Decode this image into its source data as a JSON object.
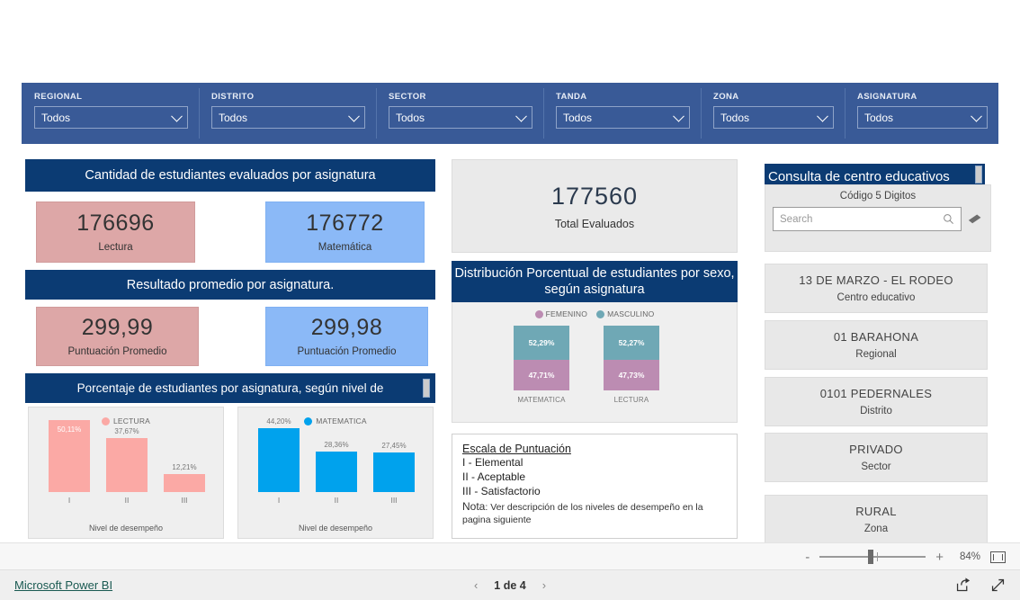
{
  "filters": {
    "slicers": [
      {
        "label": "REGIONAL",
        "value": "Todos"
      },
      {
        "label": "DISTRITO",
        "value": "Todos"
      },
      {
        "label": "SECTOR",
        "value": "Todos"
      },
      {
        "label": "TANDA",
        "value": "Todos"
      },
      {
        "label": "ZONA",
        "value": "Todos"
      },
      {
        "label": "ASIGNATURA",
        "value": "Todos"
      }
    ]
  },
  "left": {
    "title_cantidad": "Cantidad de estudiantes evaluados por asignatura",
    "title_resultado": "Resultado promedio por asignatura.",
    "title_porcentaje": "Porcentaje de estudiantes por asignatura, según nivel de",
    "kpis": [
      {
        "value": "176696",
        "label": "Lectura"
      },
      {
        "value": "176772",
        "label": "Matemática"
      },
      {
        "value": "299,99",
        "label": "Puntuación Promedio"
      },
      {
        "value": "299,98",
        "label": "Puntuación Promedio"
      }
    ]
  },
  "center": {
    "total_value": "177560",
    "total_label": "Total Evaluados",
    "title_distribucion": "Distribución Porcentual de estudiantes por sexo, según asignatura",
    "escala": {
      "heading": "Escala de Puntuación",
      "line1": "I - Elemental",
      "line2": "II - Aceptable",
      "line3": "III - Satisfactorio",
      "nota_label": "Nota",
      "nota_text": ": Ver descripción de los niveles de desempeño en la pagina siguiente"
    }
  },
  "right": {
    "title": "Consulta de centro educativos",
    "search_caption": "Código 5 Digitos",
    "search_placeholder": "Search",
    "cards": [
      {
        "value": "13 DE MARZO - EL RODEO",
        "label": "Centro educativo"
      },
      {
        "value": "01 BARAHONA",
        "label": "Regional"
      },
      {
        "value": "0101  PEDERNALES",
        "label": "Distrito"
      },
      {
        "value": "PRIVADO",
        "label": "Sector"
      },
      {
        "value": "RURAL",
        "label": "Zona"
      }
    ]
  },
  "statusbar": {
    "zoom_minus": "-",
    "zoom_plus": "+",
    "zoom_percent": "84%"
  },
  "footer": {
    "brand": "Microsoft Power BI",
    "prev": "‹",
    "page": "1 de 4",
    "next": "›"
  },
  "chart_data": [
    {
      "type": "bar",
      "title": "",
      "legend": [
        "LECTURA"
      ],
      "legend_position": "top",
      "categories": [
        "I",
        "II",
        "III"
      ],
      "values": [
        50.11,
        37.67,
        12.21
      ],
      "value_labels": [
        "50,11%",
        "37,67%",
        "12,21%"
      ],
      "xlabel": "Nivel de desempeño",
      "ylabel": "",
      "ylim": [
        0,
        55
      ],
      "color": "#fba9a5",
      "grid": false
    },
    {
      "type": "bar",
      "title": "",
      "legend": [
        "MATEMATICA"
      ],
      "legend_position": "top",
      "categories": [
        "I",
        "II",
        "III"
      ],
      "values": [
        44.2,
        28.36,
        27.45
      ],
      "value_labels": [
        "44,20%",
        "28,36%",
        "27,45%"
      ],
      "xlabel": "Nivel de desempeño",
      "ylabel": "",
      "ylim": [
        0,
        55
      ],
      "color": "#00a2ed",
      "grid": false
    },
    {
      "type": "bar",
      "subtype": "stacked-100",
      "title": "Distribución Porcentual de estudiantes por sexo, según asignatura",
      "categories": [
        "MATEMATICA",
        "LECTURA"
      ],
      "series": [
        {
          "name": "MASCULINO",
          "values": [
            52.29,
            52.27
          ],
          "labels": [
            "52,29%",
            "52,27%"
          ],
          "color": "#6fa8b5"
        },
        {
          "name": "FEMENINO",
          "values": [
            47.71,
            47.73
          ],
          "labels": [
            "47,71%",
            "47,73%"
          ],
          "color": "#bc8cb2"
        }
      ],
      "legend": [
        "FEMENINO",
        "MASCULINO"
      ],
      "legend_position": "top",
      "ylim": [
        0,
        100
      ],
      "grid": false
    }
  ],
  "colors": {
    "header_blue": "#0b3b73",
    "filter_blue": "#395a97",
    "pink": "#dda7a7",
    "blue": "#8bb9f7",
    "lectura": "#fba9a5",
    "matematica": "#00a2ed",
    "femenino": "#bc8cb2",
    "masculino": "#6fa8b5"
  }
}
